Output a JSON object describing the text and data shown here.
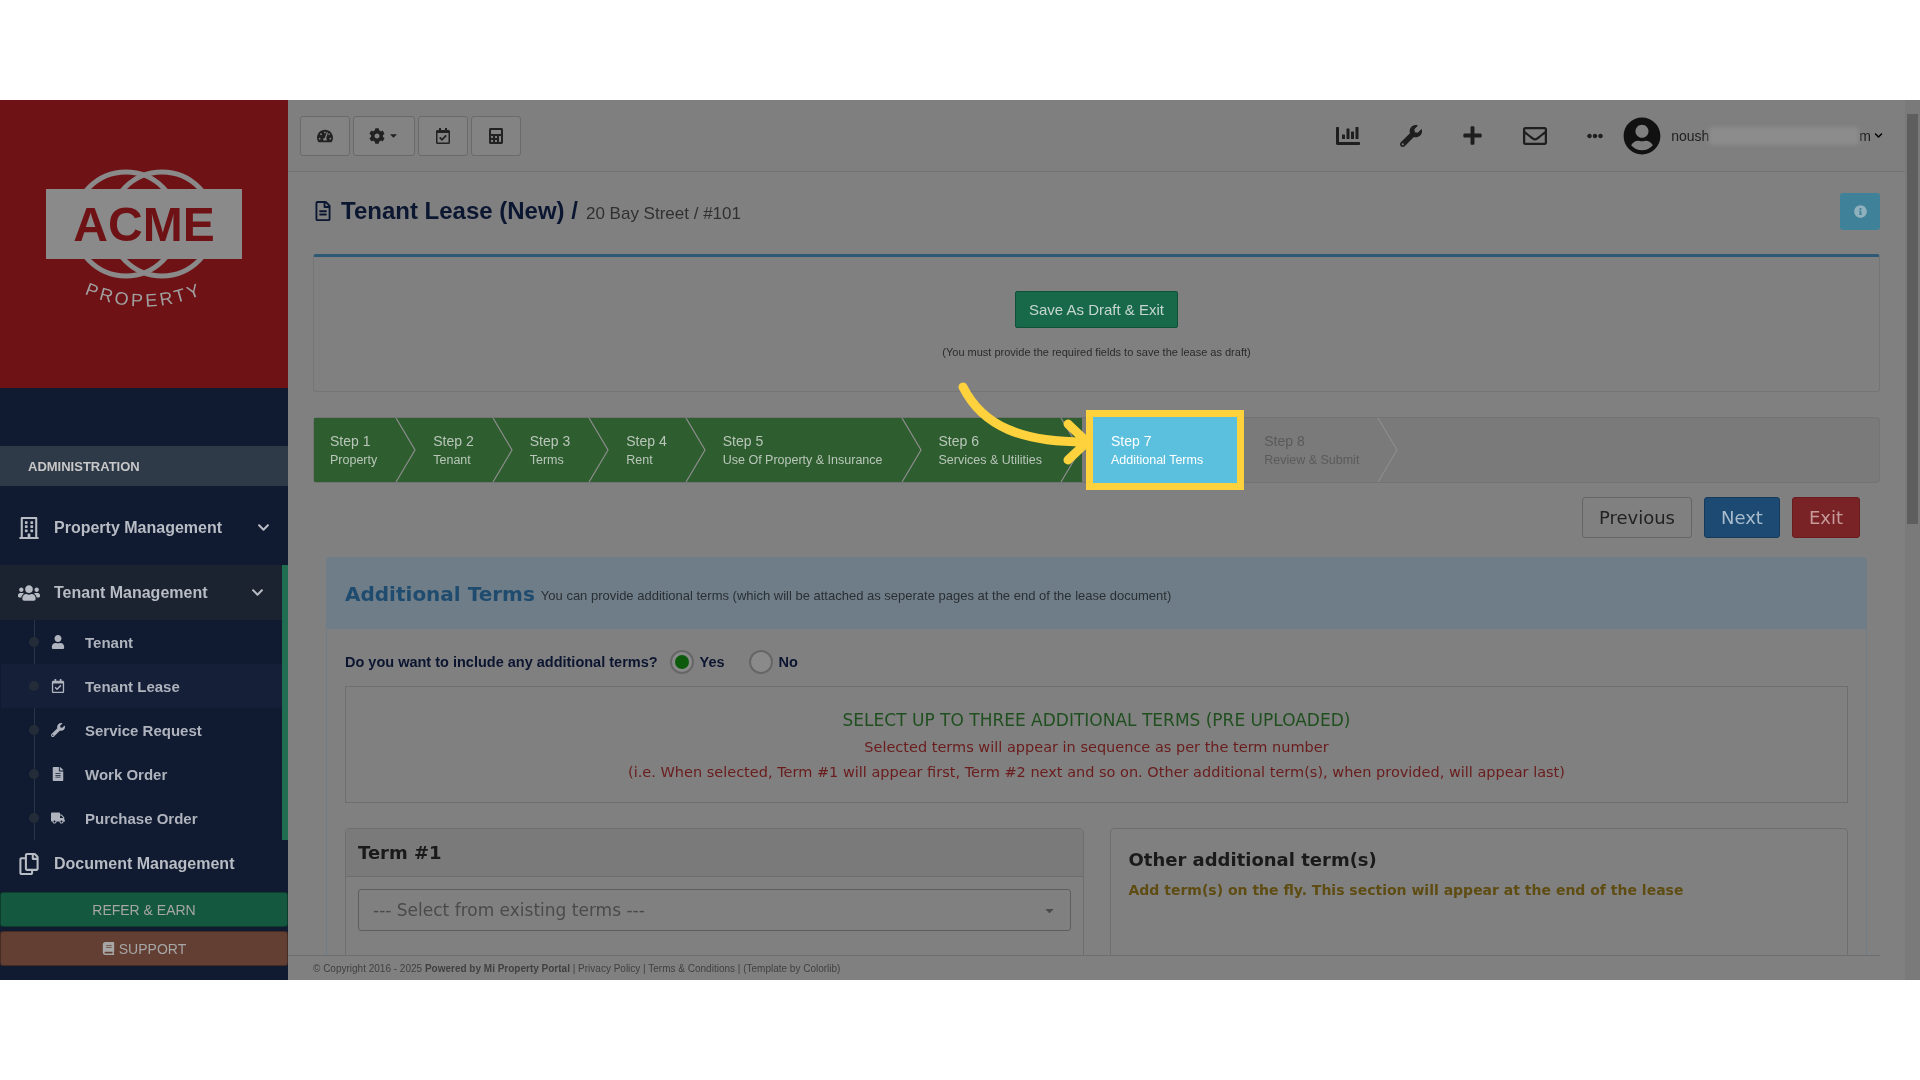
{
  "sidebar": {
    "logo": {
      "name": "ACME",
      "tagline": "PROPERTY"
    },
    "section": "ADMINISTRATION",
    "items": [
      {
        "label": "Property Management",
        "expanded": false
      },
      {
        "label": "Tenant Management",
        "expanded": true,
        "children": [
          {
            "label": "Tenant",
            "selected": false
          },
          {
            "label": "Tenant Lease",
            "selected": true
          },
          {
            "label": "Service Request",
            "selected": false
          },
          {
            "label": "Work Order",
            "selected": false
          },
          {
            "label": "Purchase Order",
            "selected": false
          }
        ]
      },
      {
        "label": "Document Management"
      }
    ],
    "buttons": [
      {
        "label": "REFER & EARN",
        "kind": "refer"
      },
      {
        "label": "SUPPORT",
        "kind": "support"
      }
    ]
  },
  "topbar": {
    "user": {
      "name_start": "noush",
      "name_end": "m"
    }
  },
  "page": {
    "title": "Tenant Lease (New) /",
    "subtitle": "20 Bay Street / #101"
  },
  "draft": {
    "button": "Save As Draft & Exit",
    "hint": "(You must provide the required fields to save the lease as draft)"
  },
  "steps": [
    {
      "title": "Step 1",
      "label": "Property",
      "completed": true,
      "selected": false
    },
    {
      "title": "Step 2",
      "label": "Tenant",
      "completed": true,
      "selected": false
    },
    {
      "title": "Step 3",
      "label": "Terms",
      "completed": true,
      "selected": false
    },
    {
      "title": "Step 4",
      "label": "Rent",
      "completed": true,
      "selected": false
    },
    {
      "title": "Step 5",
      "label": "Use Of Property & Insurance",
      "completed": true,
      "selected": false
    },
    {
      "title": "Step 6",
      "label": "Services & Utilities",
      "completed": true,
      "selected": false
    },
    {
      "title": "Step 7",
      "label": "Additional Terms",
      "selected": true
    },
    {
      "title": "Step 8",
      "label": "Review & Submit",
      "completed": false,
      "selected": false
    }
  ],
  "nav_buttons": [
    {
      "label": "Previous",
      "kind": "default"
    },
    {
      "label": "Next",
      "kind": "primary"
    },
    {
      "label": "Exit",
      "kind": "danger"
    }
  ],
  "panel": {
    "title": "Additional Terms",
    "description": "You can provide additional terms (which will be attached as seperate pages at the end of the lease document)",
    "question": "Do you want to include any additional terms?",
    "options": [
      {
        "label": "Yes",
        "selected": true
      },
      {
        "label": "No",
        "selected": false
      }
    ],
    "notice": {
      "heading": "SELECT UP TO THREE ADDITIONAL TERMS (PRE UPLOADED)",
      "lines": [
        "Selected terms will appear in sequence as per the term number",
        "(i.e. When selected, Term #1 will appear first, Term #2 next and so on. Other additional term(s), when provided, will appear last)"
      ]
    },
    "term": {
      "title": "Term #1",
      "placeholder": "--- Select from existing terms ---"
    },
    "other": {
      "title": "Other additional term(s)",
      "text": "Add term(s) on the fly. This section will appear at the end of the lease"
    }
  },
  "footer": {
    "text": "© Copyright 2016 - 2025 **Powered by Mi Property Portal** | Privacy Policy | Terms & Conditions | (Template by Colorlib)"
  }
}
